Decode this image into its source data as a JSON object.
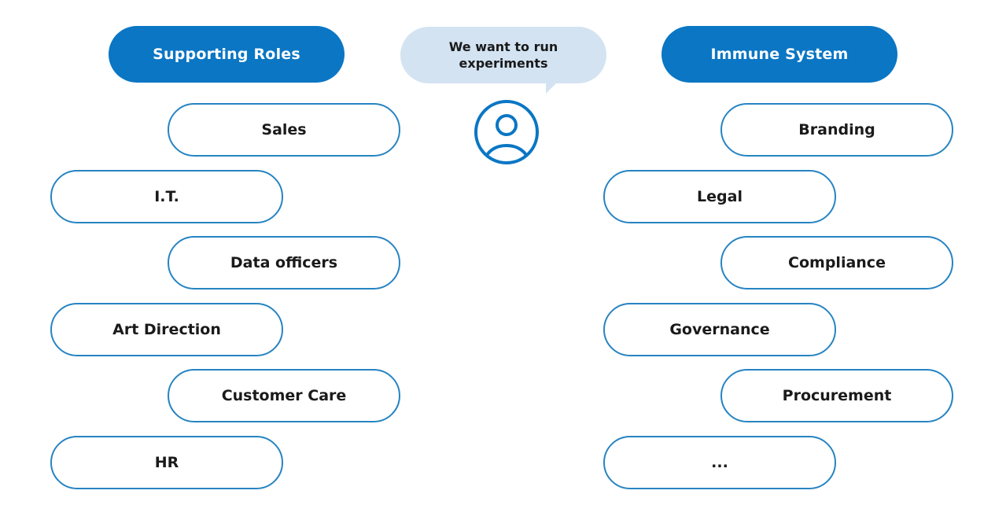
{
  "colors": {
    "header_fill": "#0a76c4",
    "pill_border": "#2784c2",
    "bubble_fill": "#d3e3f2",
    "text": "#1a1a1a"
  },
  "left_group": {
    "title": "Supporting Roles",
    "items": [
      "Sales",
      "I.T.",
      "Data officers",
      "Art Direction",
      "Customer Care",
      "HR"
    ]
  },
  "center": {
    "speech_bubble": "We want to run experiments",
    "icon": "user-avatar-icon"
  },
  "right_group": {
    "title": "Immune System",
    "items": [
      "Branding",
      "Legal",
      "Compliance",
      "Governance",
      "Procurement",
      "..."
    ]
  }
}
